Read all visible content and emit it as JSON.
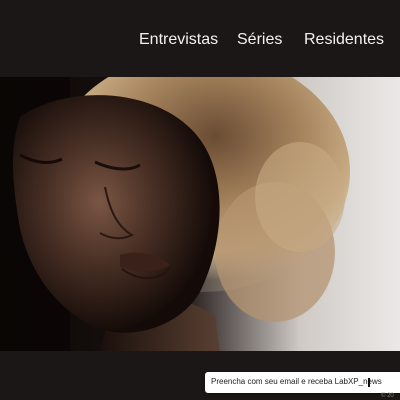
{
  "nav": {
    "items": [
      {
        "label": "Entrevistas"
      },
      {
        "label": "Séries"
      },
      {
        "label": "Residentes"
      }
    ]
  },
  "hero": {
    "image": "woman-curly-hair-closed-eyes-portrait"
  },
  "newsletter": {
    "text": "Preencha com seu email e receba LabXP_news"
  },
  "footer": {
    "copyright": "© 20"
  },
  "colors": {
    "background": "#1b1716",
    "nav_text": "#f2f2f2",
    "hero_backdrop": "#e8e6e4",
    "hair": "#b89a72",
    "skin": "#6b4a3a"
  }
}
